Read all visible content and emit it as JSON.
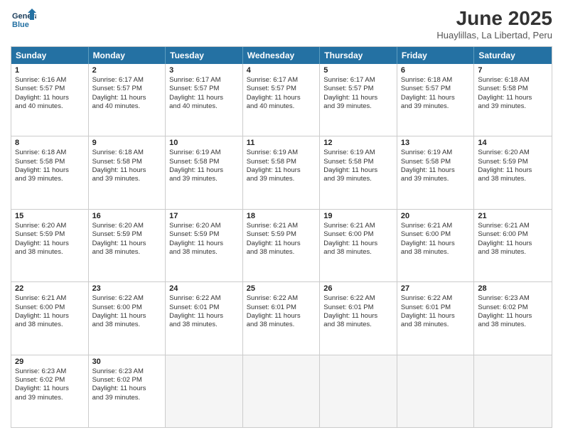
{
  "logo": {
    "line1": "General",
    "line2": "Blue"
  },
  "title": "June 2025",
  "location": "Huaylillas, La Libertad, Peru",
  "headers": [
    "Sunday",
    "Monday",
    "Tuesday",
    "Wednesday",
    "Thursday",
    "Friday",
    "Saturday"
  ],
  "rows": [
    [
      {
        "day": "1",
        "lines": [
          "Sunrise: 6:16 AM",
          "Sunset: 5:57 PM",
          "Daylight: 11 hours",
          "and 40 minutes."
        ]
      },
      {
        "day": "2",
        "lines": [
          "Sunrise: 6:17 AM",
          "Sunset: 5:57 PM",
          "Daylight: 11 hours",
          "and 40 minutes."
        ]
      },
      {
        "day": "3",
        "lines": [
          "Sunrise: 6:17 AM",
          "Sunset: 5:57 PM",
          "Daylight: 11 hours",
          "and 40 minutes."
        ]
      },
      {
        "day": "4",
        "lines": [
          "Sunrise: 6:17 AM",
          "Sunset: 5:57 PM",
          "Daylight: 11 hours",
          "and 40 minutes."
        ]
      },
      {
        "day": "5",
        "lines": [
          "Sunrise: 6:17 AM",
          "Sunset: 5:57 PM",
          "Daylight: 11 hours",
          "and 39 minutes."
        ]
      },
      {
        "day": "6",
        "lines": [
          "Sunrise: 6:18 AM",
          "Sunset: 5:57 PM",
          "Daylight: 11 hours",
          "and 39 minutes."
        ]
      },
      {
        "day": "7",
        "lines": [
          "Sunrise: 6:18 AM",
          "Sunset: 5:58 PM",
          "Daylight: 11 hours",
          "and 39 minutes."
        ]
      }
    ],
    [
      {
        "day": "8",
        "lines": [
          "Sunrise: 6:18 AM",
          "Sunset: 5:58 PM",
          "Daylight: 11 hours",
          "and 39 minutes."
        ]
      },
      {
        "day": "9",
        "lines": [
          "Sunrise: 6:18 AM",
          "Sunset: 5:58 PM",
          "Daylight: 11 hours",
          "and 39 minutes."
        ]
      },
      {
        "day": "10",
        "lines": [
          "Sunrise: 6:19 AM",
          "Sunset: 5:58 PM",
          "Daylight: 11 hours",
          "and 39 minutes."
        ]
      },
      {
        "day": "11",
        "lines": [
          "Sunrise: 6:19 AM",
          "Sunset: 5:58 PM",
          "Daylight: 11 hours",
          "and 39 minutes."
        ]
      },
      {
        "day": "12",
        "lines": [
          "Sunrise: 6:19 AM",
          "Sunset: 5:58 PM",
          "Daylight: 11 hours",
          "and 39 minutes."
        ]
      },
      {
        "day": "13",
        "lines": [
          "Sunrise: 6:19 AM",
          "Sunset: 5:58 PM",
          "Daylight: 11 hours",
          "and 39 minutes."
        ]
      },
      {
        "day": "14",
        "lines": [
          "Sunrise: 6:20 AM",
          "Sunset: 5:59 PM",
          "Daylight: 11 hours",
          "and 38 minutes."
        ]
      }
    ],
    [
      {
        "day": "15",
        "lines": [
          "Sunrise: 6:20 AM",
          "Sunset: 5:59 PM",
          "Daylight: 11 hours",
          "and 38 minutes."
        ]
      },
      {
        "day": "16",
        "lines": [
          "Sunrise: 6:20 AM",
          "Sunset: 5:59 PM",
          "Daylight: 11 hours",
          "and 38 minutes."
        ]
      },
      {
        "day": "17",
        "lines": [
          "Sunrise: 6:20 AM",
          "Sunset: 5:59 PM",
          "Daylight: 11 hours",
          "and 38 minutes."
        ]
      },
      {
        "day": "18",
        "lines": [
          "Sunrise: 6:21 AM",
          "Sunset: 5:59 PM",
          "Daylight: 11 hours",
          "and 38 minutes."
        ]
      },
      {
        "day": "19",
        "lines": [
          "Sunrise: 6:21 AM",
          "Sunset: 6:00 PM",
          "Daylight: 11 hours",
          "and 38 minutes."
        ]
      },
      {
        "day": "20",
        "lines": [
          "Sunrise: 6:21 AM",
          "Sunset: 6:00 PM",
          "Daylight: 11 hours",
          "and 38 minutes."
        ]
      },
      {
        "day": "21",
        "lines": [
          "Sunrise: 6:21 AM",
          "Sunset: 6:00 PM",
          "Daylight: 11 hours",
          "and 38 minutes."
        ]
      }
    ],
    [
      {
        "day": "22",
        "lines": [
          "Sunrise: 6:21 AM",
          "Sunset: 6:00 PM",
          "Daylight: 11 hours",
          "and 38 minutes."
        ]
      },
      {
        "day": "23",
        "lines": [
          "Sunrise: 6:22 AM",
          "Sunset: 6:00 PM",
          "Daylight: 11 hours",
          "and 38 minutes."
        ]
      },
      {
        "day": "24",
        "lines": [
          "Sunrise: 6:22 AM",
          "Sunset: 6:01 PM",
          "Daylight: 11 hours",
          "and 38 minutes."
        ]
      },
      {
        "day": "25",
        "lines": [
          "Sunrise: 6:22 AM",
          "Sunset: 6:01 PM",
          "Daylight: 11 hours",
          "and 38 minutes."
        ]
      },
      {
        "day": "26",
        "lines": [
          "Sunrise: 6:22 AM",
          "Sunset: 6:01 PM",
          "Daylight: 11 hours",
          "and 38 minutes."
        ]
      },
      {
        "day": "27",
        "lines": [
          "Sunrise: 6:22 AM",
          "Sunset: 6:01 PM",
          "Daylight: 11 hours",
          "and 38 minutes."
        ]
      },
      {
        "day": "28",
        "lines": [
          "Sunrise: 6:23 AM",
          "Sunset: 6:02 PM",
          "Daylight: 11 hours",
          "and 38 minutes."
        ]
      }
    ],
    [
      {
        "day": "29",
        "lines": [
          "Sunrise: 6:23 AM",
          "Sunset: 6:02 PM",
          "Daylight: 11 hours",
          "and 39 minutes."
        ]
      },
      {
        "day": "30",
        "lines": [
          "Sunrise: 6:23 AM",
          "Sunset: 6:02 PM",
          "Daylight: 11 hours",
          "and 39 minutes."
        ]
      },
      {
        "day": "",
        "lines": []
      },
      {
        "day": "",
        "lines": []
      },
      {
        "day": "",
        "lines": []
      },
      {
        "day": "",
        "lines": []
      },
      {
        "day": "",
        "lines": []
      }
    ]
  ]
}
